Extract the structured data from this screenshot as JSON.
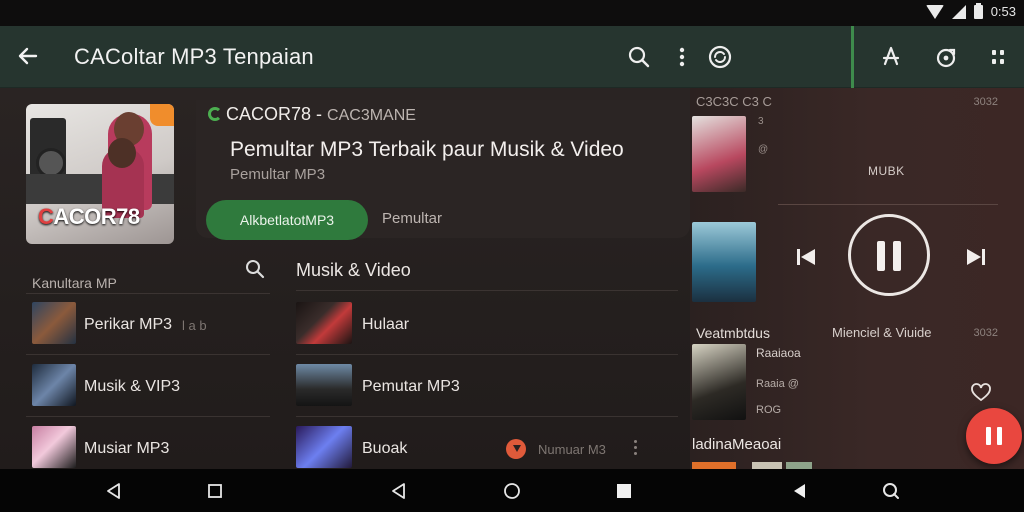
{
  "status": {
    "time": "0:53"
  },
  "appbar": {
    "title": "CAColtar MP3 Tenpaian"
  },
  "header": {
    "app_name": "CACOR78 -",
    "app_name_suffix": "CAC3MANE",
    "tagline": "Pemultar MP3 Terbaik paur Musik & Video",
    "subline": "Pemultar MP3",
    "primary_button": "AlkbetlatotMP3",
    "secondary_button": "Pemultar"
  },
  "album": {
    "brand_c": "C",
    "brand": "ACOR78"
  },
  "left_list": {
    "title": "Kanultara MP",
    "items": [
      {
        "label": "Perikar MP3",
        "meta": "l a b"
      },
      {
        "label": "Musik & VIP3"
      },
      {
        "label": "Musiar MP3"
      }
    ]
  },
  "right_list": {
    "title": "Musik & Video",
    "items": [
      {
        "label": "Hulaar"
      },
      {
        "label": "Pemutar MP3"
      },
      {
        "label": "Buoak",
        "meta": "Numuar M3"
      }
    ]
  },
  "player": {
    "top_left": "C3C3C C3 C",
    "top_right": "3032",
    "heading": "MUBK",
    "col1": "Veatmbtdus",
    "col2": "Mienciel & Viuide",
    "col3": "3032",
    "entry_a": "Raaiaoa",
    "entry_b": "Raaia  @",
    "entry_c": "ROG",
    "bottom_title": "ladinaMeaoai",
    "small_a": "3",
    "small_b": "@"
  },
  "colors": {
    "accent_green": "#2f7a3d",
    "fab_red": "#e9473f",
    "appbar": "#26352f"
  }
}
